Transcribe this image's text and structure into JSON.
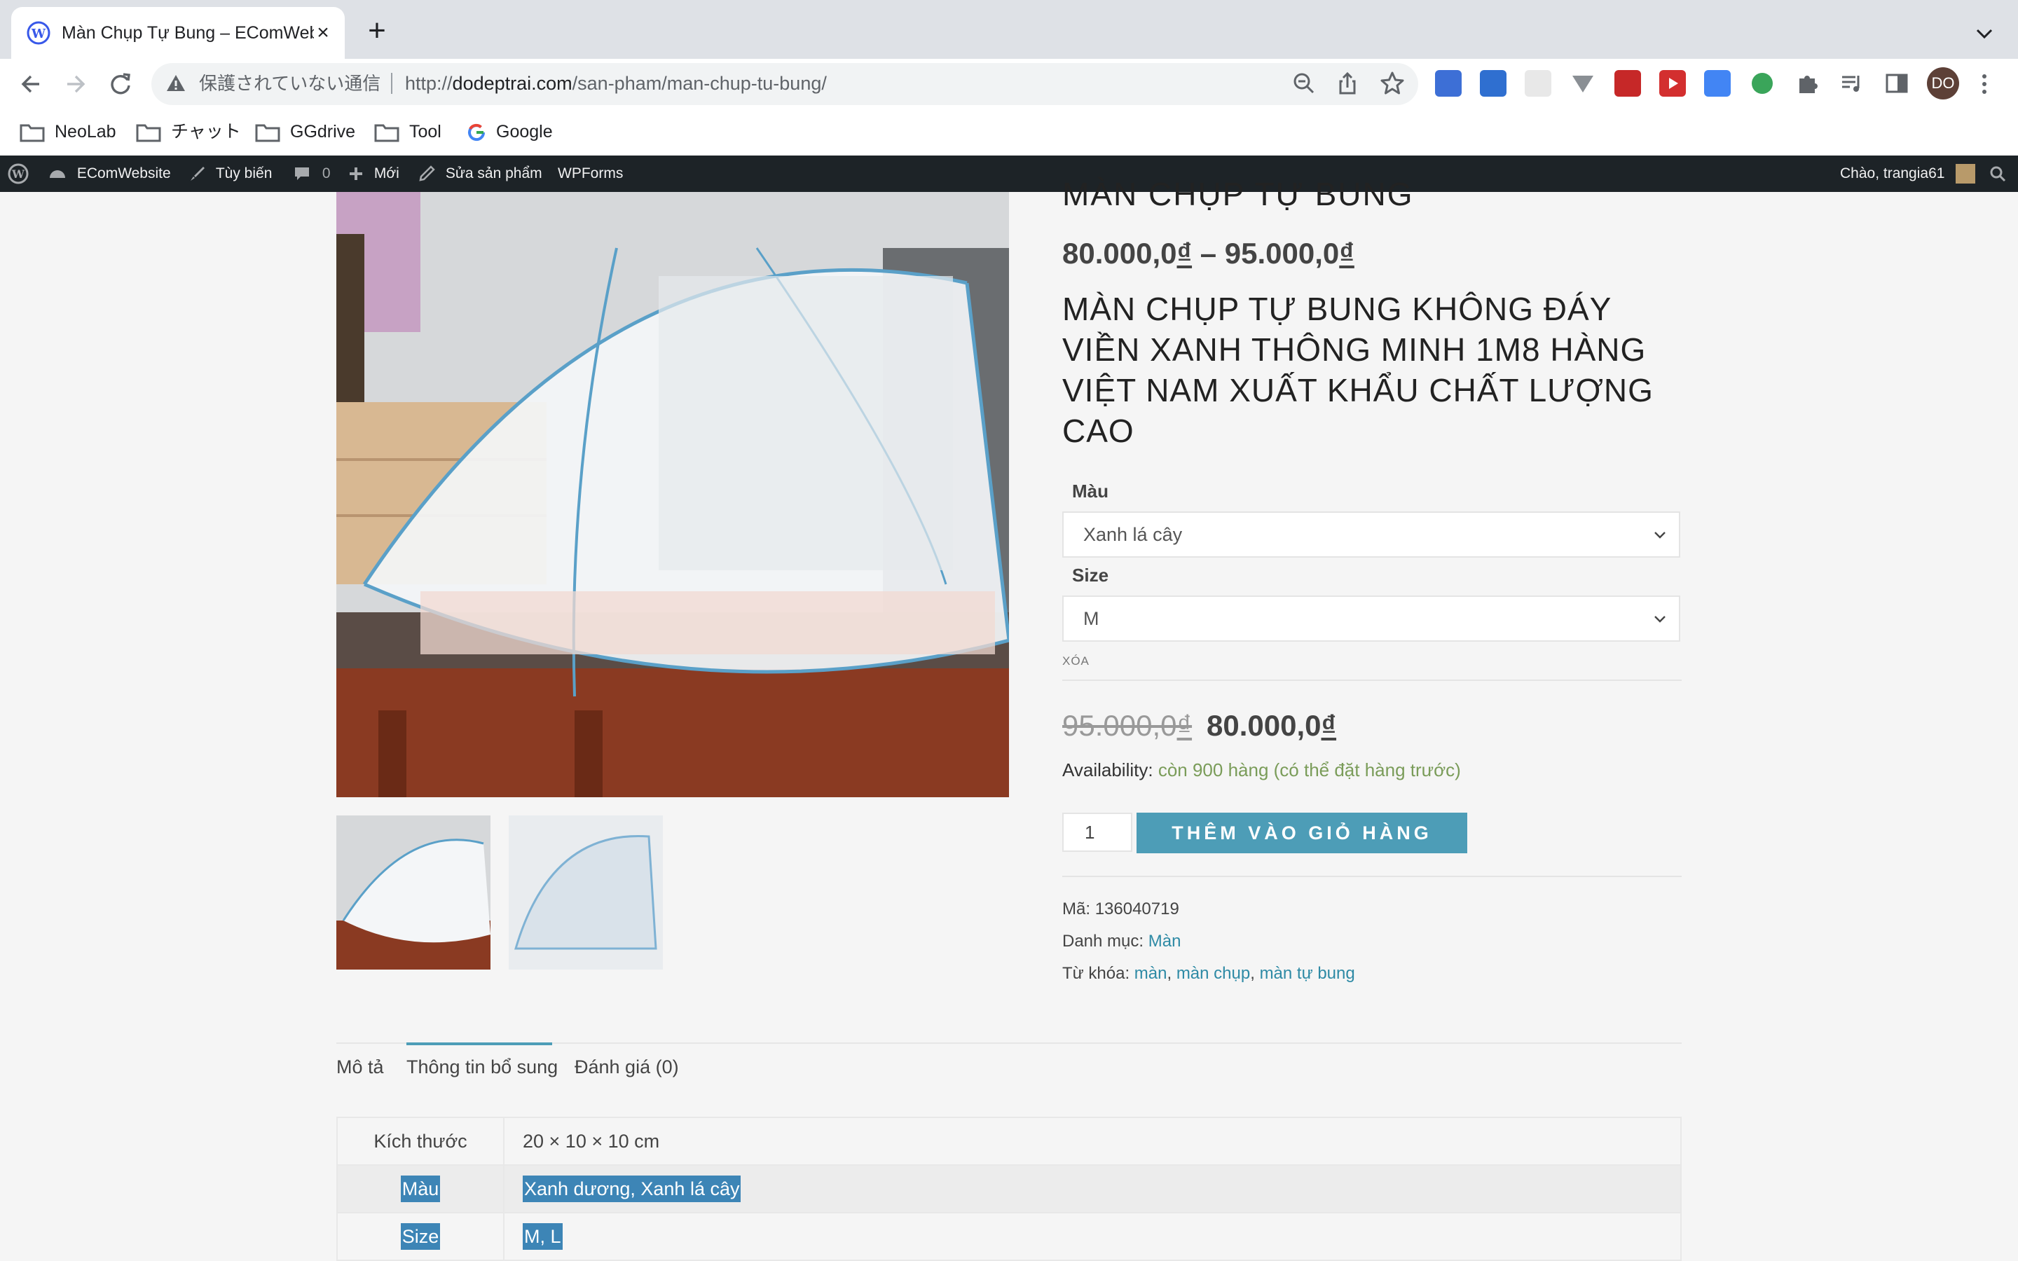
{
  "browser": {
    "tab_title": "Màn Chụp Tự Bung – EComWebsite",
    "security_label": "保護されていない通信",
    "url_scheme": "http://",
    "url_host": "dodeptrai.com",
    "url_path": "/san-pham/man-chup-tu-bung/",
    "profile_initials": "DO",
    "bookmarks": [
      "NeoLab",
      "チャット",
      "GGdrive",
      "Tool",
      "Google"
    ]
  },
  "adminbar": {
    "site_name": "EComWebsite",
    "customize": "Tùy biến",
    "comments_count": "0",
    "new": "Mới",
    "edit_product": "Sửa sản phẩm",
    "wpforms": "WPForms",
    "greeting": "Chào, trangia61"
  },
  "product": {
    "title": "MÀN CHỤP TỰ BUNG",
    "price_range_low": "80.000,0",
    "price_range_sep": " – ",
    "price_range_high": "95.000,0",
    "currency": "₫",
    "heading": "MÀN CHỤP TỰ BUNG KHÔNG ĐÁY VIỀN XANH THÔNG MINH 1M8 HÀNG VIỆT NAM XUẤT KHẨU CHẤT LƯỢNG CAO",
    "variation_color_label": "Màu",
    "variation_color_value": "Xanh lá cây",
    "variation_size_label": "Size",
    "variation_size_value": "M",
    "reset_label": "XÓA",
    "regular_price": "95.000,0",
    "sale_price": "80.000,0",
    "availability_label": "Availability:",
    "availability_value": "còn 900 hàng (có thể đặt hàng trước)",
    "quantity": "1",
    "add_to_cart": "THÊM VÀO GIỎ HÀNG",
    "sku_label": "Mã:",
    "sku": "136040719",
    "category_label": "Danh mục:",
    "category": "Màn",
    "tags_label": "Từ khóa:",
    "tags": [
      "màn",
      "màn chụp",
      "màn tự bung"
    ]
  },
  "tabs": [
    "Mô tả",
    "Thông tin bổ sung",
    "Đánh giá (0)"
  ],
  "attributes": [
    {
      "name": "Kích thước",
      "value": "20 × 10 × 10 cm"
    },
    {
      "name": "Màu",
      "value": "Xanh dương, Xanh lá cây"
    },
    {
      "name": "Size",
      "value": "M, L"
    }
  ],
  "colors": {
    "accent": "#4d9db7",
    "admin_bar": "#1d2327",
    "stock_green": "#7a9c59",
    "link": "#2e8aa5"
  }
}
